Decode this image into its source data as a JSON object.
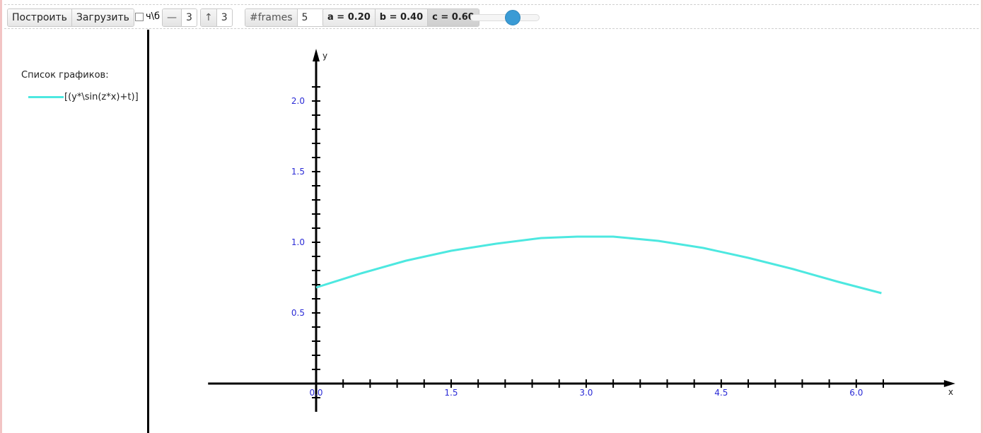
{
  "toolbar": {
    "build_label": "Построить",
    "load_label": "Загрузить",
    "bw_label": "ч\\б",
    "line_width_icon": "—",
    "line_width_value": "3",
    "arrow_icon": "↑",
    "arrow_value": "3",
    "frames_label": "#frames",
    "frames_value": "5",
    "params": [
      {
        "label": "a = 0.20",
        "active": false
      },
      {
        "label": "b = 0.40",
        "active": false
      },
      {
        "label": "c = 0.60",
        "active": true
      }
    ],
    "slider_value": 0.6
  },
  "legend": {
    "title": "Список графиков:",
    "items": [
      {
        "label": "[(y*\\sin(z*x)+t)]",
        "color": "#4de8e0"
      }
    ]
  },
  "chart_data": {
    "type": "line",
    "xlabel": "x",
    "ylabel": "y",
    "x_ticks": [
      "0.0",
      "1.5",
      "3.0",
      "4.5",
      "6.0"
    ],
    "y_ticks": [
      "0.5",
      "1.0",
      "1.5",
      "2.0"
    ],
    "xlim": [
      -1.2,
      7.1
    ],
    "ylim": [
      -0.2,
      2.35
    ],
    "series": [
      {
        "color": "#4de8e0",
        "x": [
          0.0,
          0.5,
          1.0,
          1.5,
          2.0,
          2.5,
          2.9,
          3.3,
          3.8,
          4.3,
          4.8,
          5.3,
          5.8,
          6.28
        ],
        "y": [
          0.68,
          0.78,
          0.87,
          0.94,
          0.99,
          1.03,
          1.04,
          1.04,
          1.01,
          0.96,
          0.89,
          0.81,
          0.72,
          0.64
        ]
      }
    ]
  }
}
